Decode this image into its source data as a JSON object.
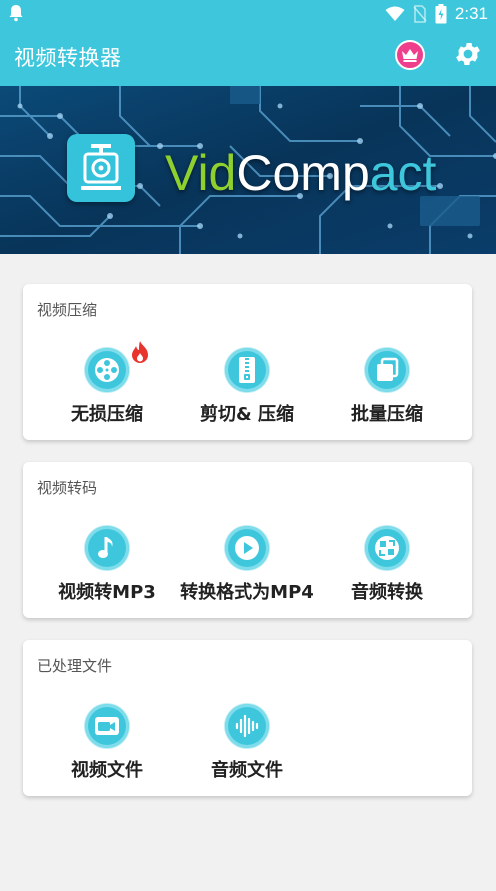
{
  "status_bar": {
    "time": "2:31"
  },
  "app_bar": {
    "title": "视频转换器",
    "crown_icon": "crown-icon",
    "settings_icon": "gear-icon"
  },
  "banner": {
    "brand_vid": "Vid",
    "brand_comp": "Comp",
    "brand_act": "act"
  },
  "sections": [
    {
      "title": "视频压缩",
      "items": [
        {
          "label": "无损压缩",
          "icon": "film-reel-icon",
          "badge": "fire-icon"
        },
        {
          "label": "剪切& 压缩",
          "icon": "zip-icon"
        },
        {
          "label": "批量压缩",
          "icon": "stack-icon"
        }
      ]
    },
    {
      "title": "视频转码",
      "items": [
        {
          "label": "视频转MP3",
          "icon": "music-note-icon"
        },
        {
          "label": "转换格式为MP4",
          "icon": "play-icon"
        },
        {
          "label": "音频转换",
          "icon": "convert-icon"
        }
      ]
    },
    {
      "title": "已处理文件",
      "items": [
        {
          "label": "视频文件",
          "icon": "video-camera-icon"
        },
        {
          "label": "音频文件",
          "icon": "audio-wave-icon"
        }
      ]
    }
  ],
  "colors": {
    "primary": "#3ec7dc",
    "crown_bg": "#ef3f8c",
    "brand_green": "#8ed12f",
    "fire": "#e8342c"
  }
}
